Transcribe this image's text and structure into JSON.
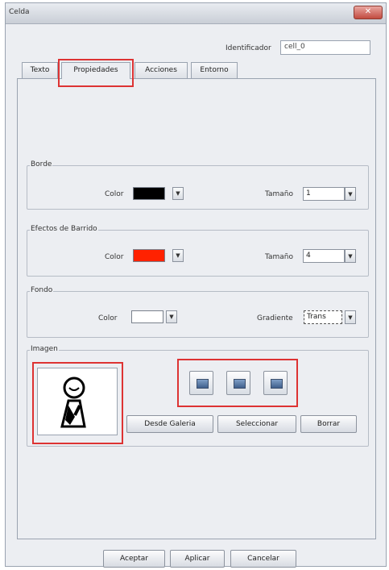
{
  "window": {
    "title": "Celda",
    "close_icon": "close-icon"
  },
  "identifier": {
    "label": "Identificador",
    "value": "cell_0"
  },
  "tabs": [
    {
      "label": "Texto"
    },
    {
      "label": "Propiedades"
    },
    {
      "label": "Acciones"
    },
    {
      "label": "Entorno"
    }
  ],
  "borde": {
    "title": "Borde",
    "color_label": "Color",
    "color_value": "#000000",
    "size_label": "Tamaño",
    "size_value": "1"
  },
  "barrido": {
    "title": "Efectos de Barrido",
    "color_label": "Color",
    "color_value": "#ff2200",
    "size_label": "Tamaño",
    "size_value": "4"
  },
  "fondo": {
    "title": "Fondo",
    "color_label": "Color",
    "color_value": "#ffffff",
    "gradient_label": "Gradiente",
    "gradient_value": "Trans"
  },
  "imagen": {
    "title": "Imagen",
    "buttons": {
      "gallery": "Desde Galeria",
      "select": "Seleccionar",
      "delete": "Borrar"
    }
  },
  "footer": {
    "accept": "Aceptar",
    "apply": "Aplicar",
    "cancel": "Cancelar"
  }
}
